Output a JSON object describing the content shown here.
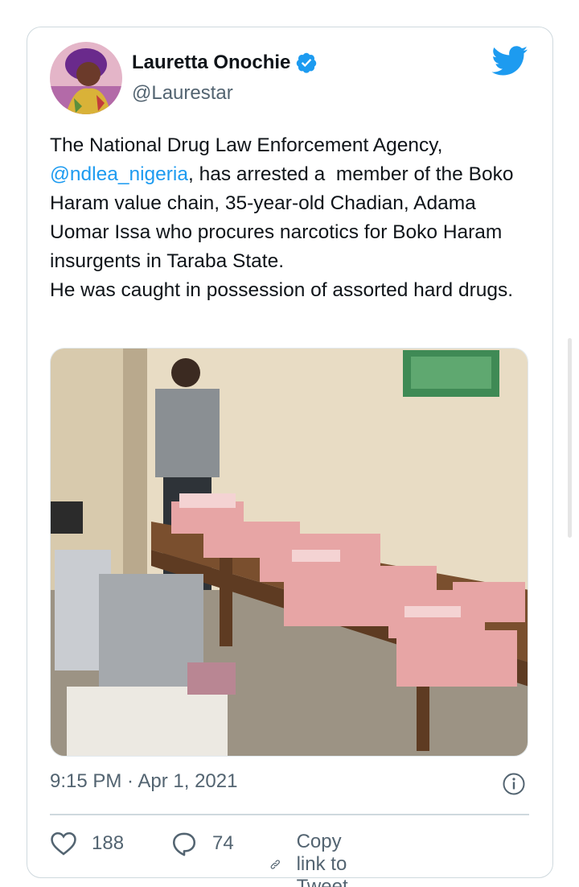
{
  "author": {
    "name": "Lauretta Onochie",
    "handle": "@Laurestar",
    "verified": true
  },
  "tweet": {
    "text_before_mention": "The National Drug Law Enforcement Agency, ",
    "mention": "@ndlea_nigeria",
    "text_after_mention": ", has arrested a  member of the Boko Haram value chain, 35-year-old Chadian, Adama Uomar Issa who procures narcotics for Boko Haram insurgents in Taraba State.\nHe was caught in possession of assorted hard drugs.",
    "timestamp": "9:15 PM · Apr 1, 2021"
  },
  "actions": {
    "likes": "188",
    "replies": "74",
    "copy_link_label": "Copy link to Tweet"
  },
  "icons": {
    "brand": "twitter-bird-icon",
    "verified": "verified-badge-icon",
    "info": "info-icon",
    "like": "heart-icon",
    "reply": "reply-bubble-icon",
    "copy": "link-icon"
  },
  "colors": {
    "accent": "#1d9bf0",
    "text": "#0f1419",
    "secondary": "#536471",
    "border": "#cfd9de"
  }
}
